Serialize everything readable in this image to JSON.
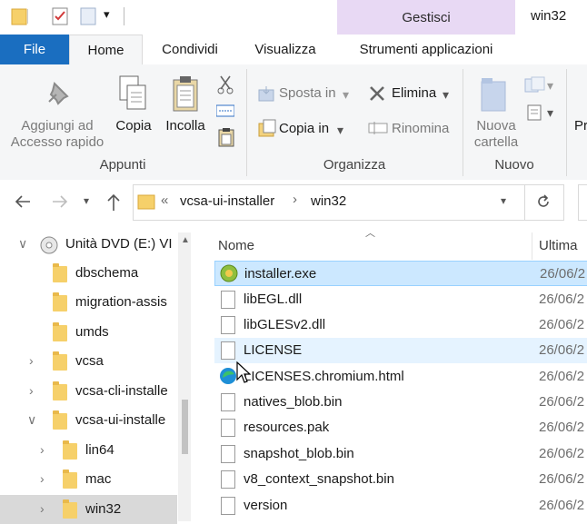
{
  "window": {
    "title": "win32",
    "contextual_group": "Gestisci"
  },
  "tabs": [
    {
      "label": "File"
    },
    {
      "label": "Home"
    },
    {
      "label": "Condividi"
    },
    {
      "label": "Visualizza"
    },
    {
      "label": "Strumenti applicazioni"
    }
  ],
  "ribbon": {
    "appunti": {
      "label": "Appunti",
      "pin": "Aggiungi ad Accesso rapido",
      "copy": "Copia",
      "paste": "Incolla"
    },
    "organizza": {
      "label": "Organizza",
      "move_to": "Sposta in",
      "copy_to": "Copia in",
      "delete": "Elimina",
      "rename": "Rinomina"
    },
    "nuovo": {
      "label": "Nuovo",
      "new_folder": "Nuova cartella"
    },
    "overflow_label": "Pr"
  },
  "address": {
    "separator": "«",
    "crumbs": [
      "vcsa-ui-installer",
      "win32"
    ]
  },
  "nav": {
    "items": [
      {
        "label": "Unità DVD (E:) VI"
      },
      {
        "label": "dbschema"
      },
      {
        "label": "migration-assis"
      },
      {
        "label": "umds"
      },
      {
        "label": "vcsa"
      },
      {
        "label": "vcsa-cli-installe"
      },
      {
        "label": "vcsa-ui-installe"
      },
      {
        "label": "lin64"
      },
      {
        "label": "mac"
      },
      {
        "label": "win32"
      }
    ]
  },
  "filelist": {
    "col_name": "Nome",
    "col_date": "Ultima",
    "files": [
      {
        "name": "installer.exe",
        "date": "26/06/2"
      },
      {
        "name": "libEGL.dll",
        "date": "26/06/2"
      },
      {
        "name": "libGLESv2.dll",
        "date": "26/06/2"
      },
      {
        "name": "LICENSE",
        "date": "26/06/2"
      },
      {
        "name": "LICENSES.chromium.html",
        "date": "26/06/2"
      },
      {
        "name": "natives_blob.bin",
        "date": "26/06/2"
      },
      {
        "name": "resources.pak",
        "date": "26/06/2"
      },
      {
        "name": "snapshot_blob.bin",
        "date": "26/06/2"
      },
      {
        "name": "v8_context_snapshot.bin",
        "date": "26/06/2"
      },
      {
        "name": "version",
        "date": "26/06/2"
      }
    ]
  },
  "colors": {
    "accent": "#1a6ec0",
    "contextual": "#e8d9f4",
    "selection": "#cce8ff",
    "folder": "#f6d06a"
  }
}
